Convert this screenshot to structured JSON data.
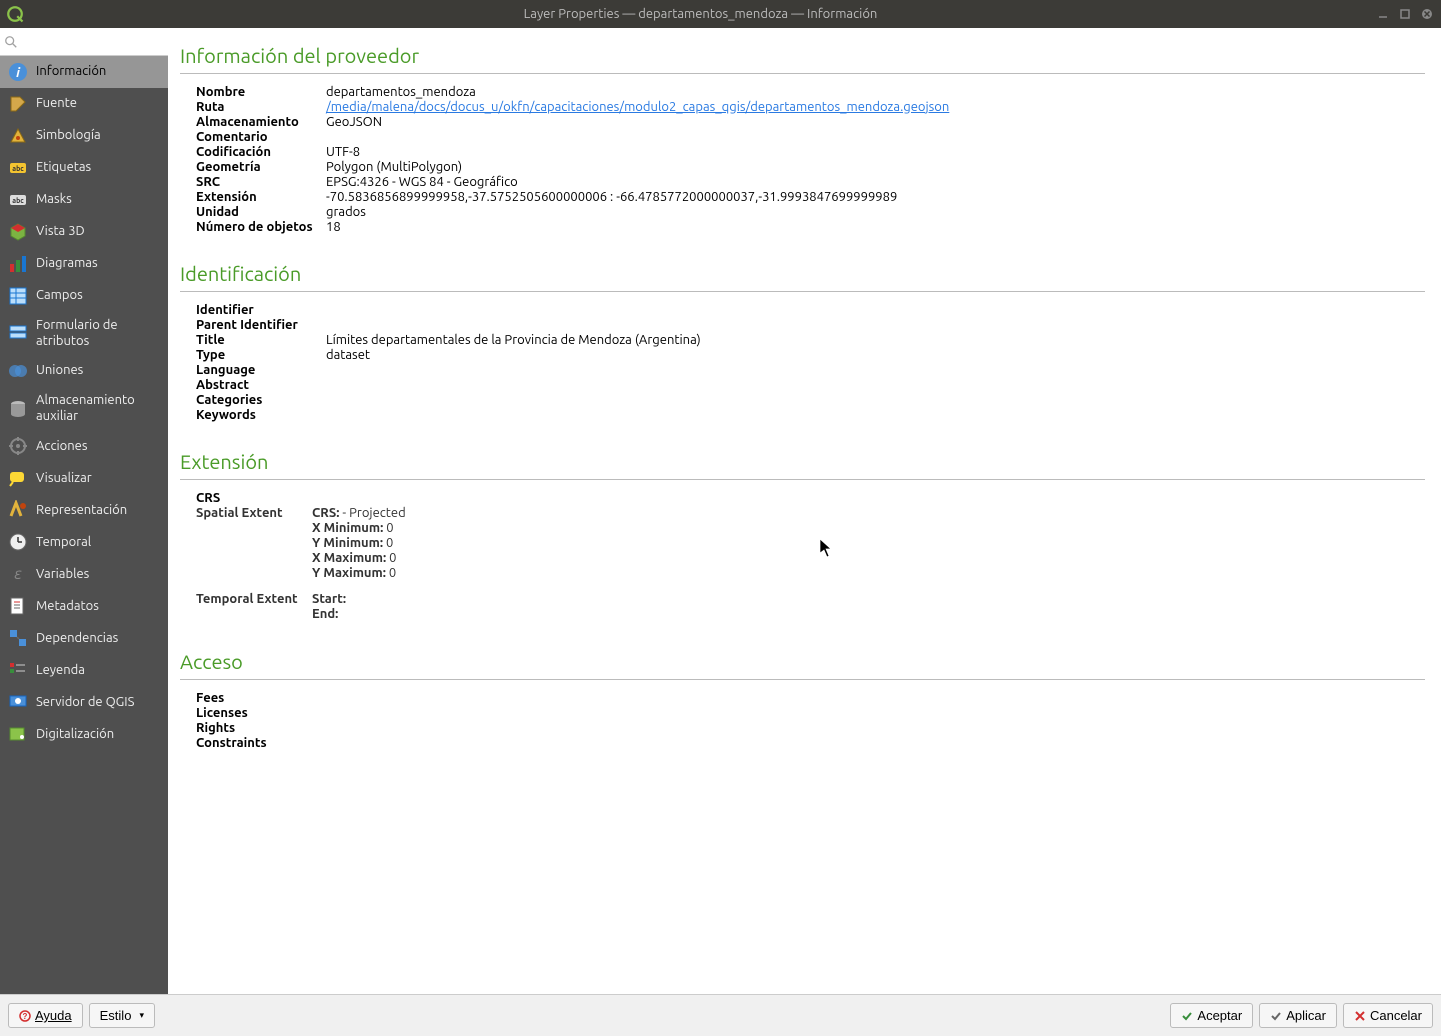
{
  "window": {
    "title": "Layer Properties — departamentos_mendoza — Información"
  },
  "search": {
    "placeholder": ""
  },
  "sidebar": {
    "items": [
      {
        "label": "Información",
        "icon": "info-icon",
        "active": true
      },
      {
        "label": "Fuente",
        "icon": "source-icon"
      },
      {
        "label": "Simbología",
        "icon": "symbology-icon"
      },
      {
        "label": "Etiquetas",
        "icon": "labels-icon"
      },
      {
        "label": "Masks",
        "icon": "masks-icon"
      },
      {
        "label": "Vista 3D",
        "icon": "view3d-icon"
      },
      {
        "label": "Diagramas",
        "icon": "diagrams-icon"
      },
      {
        "label": "Campos",
        "icon": "fields-icon"
      },
      {
        "label": "Formulario de atributos",
        "icon": "form-icon"
      },
      {
        "label": "Uniones",
        "icon": "joins-icon"
      },
      {
        "label": "Almacenamiento auxiliar",
        "icon": "storage-icon"
      },
      {
        "label": "Acciones",
        "icon": "actions-icon"
      },
      {
        "label": "Visualizar",
        "icon": "display-icon"
      },
      {
        "label": "Representación",
        "icon": "rendering-icon"
      },
      {
        "label": "Temporal",
        "icon": "temporal-icon"
      },
      {
        "label": "Variables",
        "icon": "variables-icon"
      },
      {
        "label": "Metadatos",
        "icon": "metadata-icon"
      },
      {
        "label": "Dependencias",
        "icon": "dependencies-icon"
      },
      {
        "label": "Leyenda",
        "icon": "legend-icon"
      },
      {
        "label": "Servidor de QGIS",
        "icon": "server-icon"
      },
      {
        "label": "Digitalización",
        "icon": "digitizing-icon"
      }
    ]
  },
  "sections": {
    "provider": {
      "title": "Información del proveedor",
      "rows": {
        "nombre_label": "Nombre",
        "nombre_value": "departamentos_mendoza",
        "ruta_label": "Ruta",
        "ruta_value": "/media/malena/docs/docus_u/okfn/capacitaciones/modulo2_capas_qgis/departamentos_mendoza.geojson",
        "almacenamiento_label": "Almacenamiento",
        "almacenamiento_value": "GeoJSON",
        "comentario_label": "Comentario",
        "comentario_value": "",
        "codificacion_label": "Codificación",
        "codificacion_value": "UTF-8",
        "geometria_label": "Geometría",
        "geometria_value": "Polygon (MultiPolygon)",
        "src_label": "SRC",
        "src_value": "EPSG:4326 - WGS 84 - Geográfico",
        "extension_label": "Extensión",
        "extension_value": "-70.5836856899999958,-37.5752505600000006 : -66.4785772000000037,-31.9993847699999989",
        "unidad_label": "Unidad",
        "unidad_value": "grados",
        "numobj_label": "Número de objetos",
        "numobj_value": "18"
      }
    },
    "identification": {
      "title": "Identificación",
      "rows": {
        "identifier_label": "Identifier",
        "identifier_value": "",
        "parent_label": "Parent Identifier",
        "parent_value": "",
        "title_label": "Title",
        "title_value": "Límites departamentales de la Provincia de Mendoza (Argentina)",
        "type_label": "Type",
        "type_value": "dataset",
        "language_label": "Language",
        "language_value": "",
        "abstract_label": "Abstract",
        "abstract_value": "",
        "categories_label": "Categories",
        "categories_value": "",
        "keywords_label": "Keywords",
        "keywords_value": ""
      }
    },
    "extent": {
      "title": "Extensión",
      "crs_label": "CRS",
      "crs_value": "",
      "spatial_label": "Spatial Extent",
      "spatial": {
        "crs_prefix": "CRS:",
        "crs_value": " - Projected",
        "xmin_prefix": "X Minimum:",
        "xmin_value": " 0",
        "ymin_prefix": "Y Minimum:",
        "ymin_value": " 0",
        "xmax_prefix": "X Maximum:",
        "xmax_value": " 0",
        "ymax_prefix": "Y Maximum:",
        "ymax_value": " 0"
      },
      "temporal_label": "Temporal Extent",
      "temporal": {
        "start_prefix": "Start:",
        "start_value": "",
        "end_prefix": "End:",
        "end_value": ""
      }
    },
    "access": {
      "title": "Acceso",
      "rows": {
        "fees_label": "Fees",
        "fees_value": "",
        "licenses_label": "Licenses",
        "licenses_value": "",
        "rights_label": "Rights",
        "rights_value": "",
        "constraints_label": "Constraints",
        "constraints_value": ""
      }
    }
  },
  "footer": {
    "help": "Ayuda",
    "style": "Estilo",
    "accept": "Aceptar",
    "apply": "Aplicar",
    "cancel": "Cancelar"
  }
}
